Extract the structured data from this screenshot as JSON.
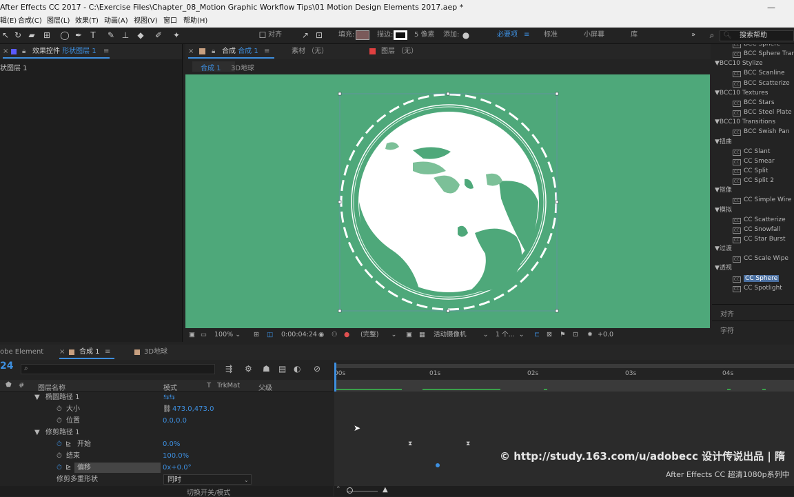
{
  "window": {
    "title": "After Effects CC 2017 - C:\\Exercise Files\\Chapter_08_Motion Graphic Workflow Tips\\01 Motion Design Elements 2017.aep *",
    "minimize_glyph": "—"
  },
  "menu": [
    "辑(E)",
    "合成(C)",
    "图层(L)",
    "效果(T)",
    "动画(A)",
    "视图(V)",
    "窗口",
    "帮助(H)"
  ],
  "toolbar": {
    "align_label": "对齐",
    "fill_label": "填充:",
    "stroke_label": "描边:",
    "stroke_width": "5 像素",
    "add_label": "添加:",
    "workspaces": [
      "必要项",
      "标准",
      "小屏幕",
      "库"
    ],
    "search_placeholder": "搜索帮助",
    "fill_color": "#7a5a5a",
    "stroke_color": "#ffffff",
    "accent_color": "#3d8fe0"
  },
  "left_panel": {
    "tab_label": "效果控件",
    "tab_target": "形状图层 1",
    "layer_label": "状图层 1"
  },
  "comp_panel": {
    "tab_prefix": "合成",
    "tab_name": "合成 1",
    "footage_tab": "素材 （无）",
    "layer_tab": "图层 （无）",
    "breadcrumb_active": "合成 1",
    "breadcrumb_next": "3D地球",
    "viewer_bg": "#4ea87a"
  },
  "viewer_footer": {
    "zoom": "100%",
    "timecode": "0:00:04:24",
    "resolution": "(完整)",
    "camera": "活动摄像机",
    "views": "1 个...",
    "exposure": "+0.0"
  },
  "effects_panel": {
    "items": [
      {
        "kind": "effect",
        "label": "BCC Sphere"
      },
      {
        "kind": "effect",
        "label": "BCC Sphere Trans"
      },
      {
        "kind": "group",
        "label": "BCC10 Stylize"
      },
      {
        "kind": "effect",
        "label": "BCC Scanline"
      },
      {
        "kind": "effect",
        "label": "BCC Scatterize"
      },
      {
        "kind": "group",
        "label": "BCC10 Textures"
      },
      {
        "kind": "effect",
        "label": "BCC Stars"
      },
      {
        "kind": "effect",
        "label": "BCC Steel Plate"
      },
      {
        "kind": "group",
        "label": "BCC10 Transitions"
      },
      {
        "kind": "effect",
        "label": "BCC Swish Pan"
      },
      {
        "kind": "group",
        "label": "扭曲"
      },
      {
        "kind": "effect",
        "label": "CC Slant"
      },
      {
        "kind": "effect",
        "label": "CC Smear"
      },
      {
        "kind": "effect",
        "label": "CC Split"
      },
      {
        "kind": "effect",
        "label": "CC Split 2"
      },
      {
        "kind": "group",
        "label": "抠像"
      },
      {
        "kind": "effect",
        "label": "CC Simple Wire Re"
      },
      {
        "kind": "group",
        "label": "模拟"
      },
      {
        "kind": "effect",
        "label": "CC Scatterize"
      },
      {
        "kind": "effect",
        "label": "CC Snowfall"
      },
      {
        "kind": "effect",
        "label": "CC Star Burst"
      },
      {
        "kind": "group",
        "label": "过渡"
      },
      {
        "kind": "effect",
        "label": "CC Scale Wipe"
      },
      {
        "kind": "group",
        "label": "透视"
      },
      {
        "kind": "effect",
        "label": "CC Sphere",
        "selected": true
      },
      {
        "kind": "effect",
        "label": "CC Spotlight"
      }
    ],
    "align_label": "对齐",
    "char_label": "字符"
  },
  "timeline": {
    "tabs": [
      "obe Element",
      "合成 1",
      "3D地球"
    ],
    "frame_number": "24",
    "columns": {
      "hash": "#",
      "name": "图层名称",
      "mode": "模式",
      "t": "T",
      "trkmat": "TrkMat",
      "parent": "父级"
    },
    "rows": [
      {
        "label": "椭圆路径 1",
        "value": ""
      },
      {
        "label": "大小",
        "value": "473.0,473.0"
      },
      {
        "label": "位置",
        "value": "0.0,0.0"
      },
      {
        "label": "修剪路径 1",
        "value": ""
      },
      {
        "label": "开始",
        "value": "0.0%"
      },
      {
        "label": "结束",
        "value": "100.0%"
      },
      {
        "label": "偏移",
        "value": "0x+0.0°"
      },
      {
        "label": "修剪多重形状",
        "value": "同时"
      }
    ],
    "toggle_label": "切换开关/模式",
    "ruler": [
      "00s",
      "01s",
      "02s",
      "03s",
      "04s"
    ]
  },
  "watermark": {
    "line1": "© http://study.163.com/u/adobecc 设计传说出品 | 隋",
    "line2": "After Effects CC 超清1080p系列中"
  }
}
